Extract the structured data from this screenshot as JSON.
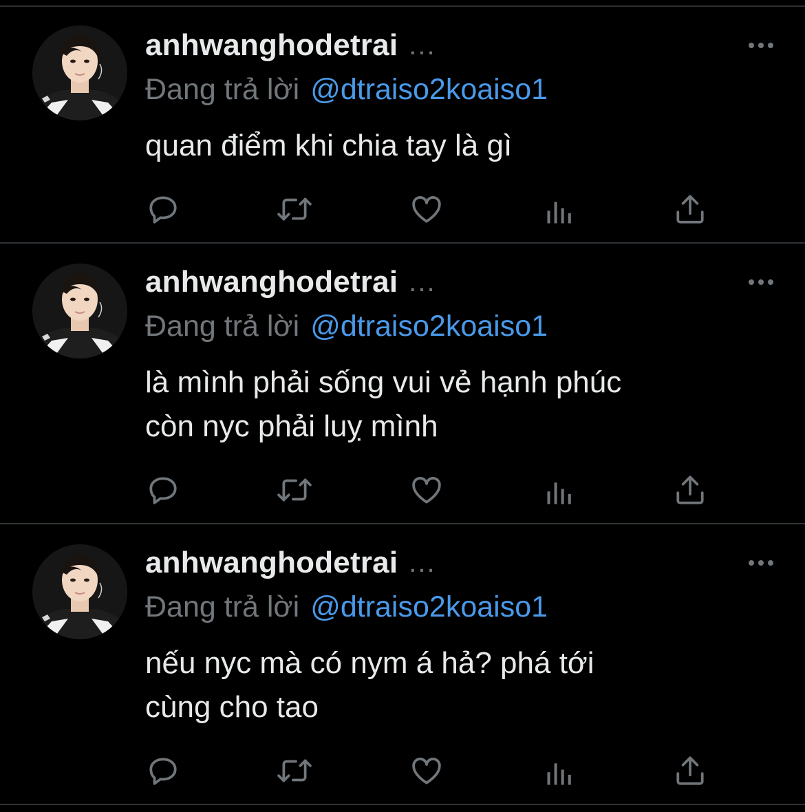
{
  "colors": {
    "background": "#000000",
    "text": "#e7e9ea",
    "muted": "#71767b",
    "link": "#4a99e9",
    "divider": "#2f3336"
  },
  "tweets": [
    {
      "username": "anhwanghodetrai",
      "ellipsis": "...",
      "reply_prefix": "Đang trả lời",
      "reply_handle": "@dtraiso2koaiso1",
      "text": "quan điểm khi chia tay là gì",
      "more_icon": "more-horizontal-icon",
      "actions": [
        "reply-icon",
        "retweet-icon",
        "like-icon",
        "analytics-icon",
        "share-icon"
      ]
    },
    {
      "username": "anhwanghodetrai",
      "ellipsis": "...",
      "reply_prefix": "Đang trả lời",
      "reply_handle": "@dtraiso2koaiso1",
      "text": "là mình phải sống vui vẻ hạnh phúc\ncòn nyc phải luỵ mình",
      "more_icon": "more-horizontal-icon",
      "actions": [
        "reply-icon",
        "retweet-icon",
        "like-icon",
        "analytics-icon",
        "share-icon"
      ]
    },
    {
      "username": "anhwanghodetrai",
      "ellipsis": "...",
      "reply_prefix": "Đang trả lời",
      "reply_handle": "@dtraiso2koaiso1",
      "text": "nếu nyc mà có nym á hả? phá tới\ncùng cho tao",
      "more_icon": "more-horizontal-icon",
      "actions": [
        "reply-icon",
        "retweet-icon",
        "like-icon",
        "analytics-icon",
        "share-icon"
      ]
    }
  ]
}
